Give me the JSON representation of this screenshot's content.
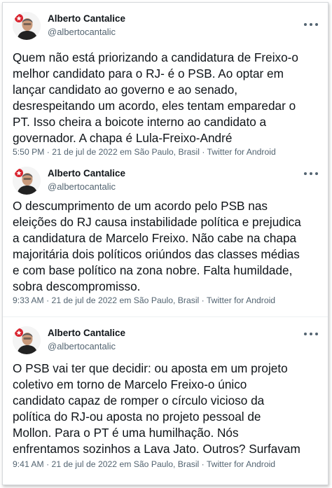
{
  "tweets": [
    {
      "author_name": "Alberto Cantalice",
      "author_handle": "@albertocantalic",
      "text": "Quem não está priorizando a candidatura de Freixo-o\nmelhor candidato para o RJ- é o PSB. Ao optar em\nlançar candidato ao governo e ao senado,\ndesrespeitando um acordo, eles tentam emparedar o\nPT. Isso cheira a boicote interno ao candidato a\ngovernador. A chapa é Lula-Freixo-André",
      "meta": "5:50 PM · 21 de jul de 2022 em São Paulo, Brasil · Twitter for Android",
      "avatar_icon": "profile-photo-icon"
    },
    {
      "author_name": "Alberto Cantalice",
      "author_handle": "@albertocantalic",
      "text": "O descumprimento de um acordo pelo PSB nas\neleições do RJ causa instabilidade política e prejudica\na candidatura de Marcelo Freixo. Não cabe na chapa\nmajoritária dois políticos oriúndos das classes médias\ne com base político na zona nobre. Falta humildade,\nsobra descompromisso.",
      "meta": "9:33 AM · 21 de jul de 2022 em São Paulo, Brasil · Twitter for Android",
      "avatar_icon": "profile-photo-icon"
    },
    {
      "author_name": "Alberto Cantalice",
      "author_handle": "@albertocantalic",
      "text": "O PSB vai ter que decidir: ou aposta em um projeto\ncoletivo em torno de Marcelo Freixo-o único\ncandidato capaz de romper o círculo vicioso da\npolítica do RJ-ou aposta no projeto pessoal de\nMollon. Para o PT é uma humilhação. Nós\nenfrentamos sozinhos a Lava Jato. Outros? Surfavam",
      "meta": "9:41 AM · 21 de jul de 2022 em São Paulo, Brasil · Twitter for Android",
      "avatar_icon": "profile-photo-icon"
    }
  ],
  "colors": {
    "text": "#0f1419",
    "secondary": "#536471",
    "avatar_accent": "#d9232e"
  },
  "icons": {
    "more": "more-options-icon"
  }
}
